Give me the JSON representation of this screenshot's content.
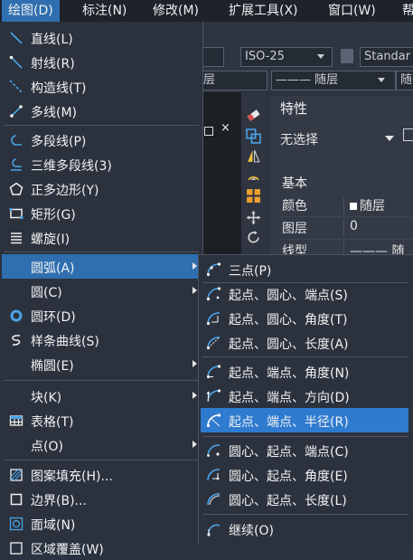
{
  "menubar": {
    "items": [
      "绘图(D)",
      "标注(N)",
      "修改(M)",
      "扩展工具(X)",
      "窗口(W)",
      "帮"
    ]
  },
  "background": {
    "toolbar": {
      "combo_dimstyle": "ISO-25",
      "combo_textstyle": "Standar",
      "combo_layer_fragment": "层",
      "combo_linetype": "——— 随层",
      "combo_lineweight_fragment": "随"
    },
    "tab_close": "×",
    "properties": {
      "title": "特性",
      "selection": "无选择",
      "section": "基本",
      "rows": [
        {
          "key": "颜色",
          "value": "随层"
        },
        {
          "key": "图层",
          "value": "0"
        },
        {
          "key": "线型",
          "value": "——— 随层"
        }
      ]
    }
  },
  "draw_menu": {
    "groups": [
      [
        "直线(L)",
        "射线(R)",
        "构造线(T)",
        "多线(M)"
      ],
      [
        "多段线(P)",
        "三维多段线(3)",
        "正多边形(Y)",
        "矩形(G)",
        "螺旋(I)"
      ],
      [
        "圆弧(A)",
        "圆(C)",
        "圆环(D)",
        "样条曲线(S)",
        "椭圆(E)"
      ],
      [
        "块(K)",
        "表格(T)",
        "点(O)"
      ],
      [
        "图案填充(H)...",
        "边界(B)...",
        "面域(N)",
        "区域覆盖(W)"
      ]
    ],
    "active_item": "圆弧(A)"
  },
  "arc_submenu": {
    "groups": [
      [
        "三点(P)"
      ],
      [
        "起点、圆心、端点(S)",
        "起点、圆心、角度(T)",
        "起点、圆心、长度(A)"
      ],
      [
        "起点、端点、角度(N)",
        "起点、端点、方向(D)",
        "起点、端点、半径(R)"
      ],
      [
        "圆心、起点、端点(C)",
        "圆心、起点、角度(E)",
        "圆心、起点、长度(L)"
      ],
      [
        "继续(O)"
      ]
    ],
    "active_item": "起点、端点、半径(R)"
  },
  "colors": {
    "menu_bg": "#2b323d",
    "highlight": "#2f6fb0",
    "submenu_highlight": "#2f7bd0",
    "icon_blue": "#4aa3e8"
  }
}
